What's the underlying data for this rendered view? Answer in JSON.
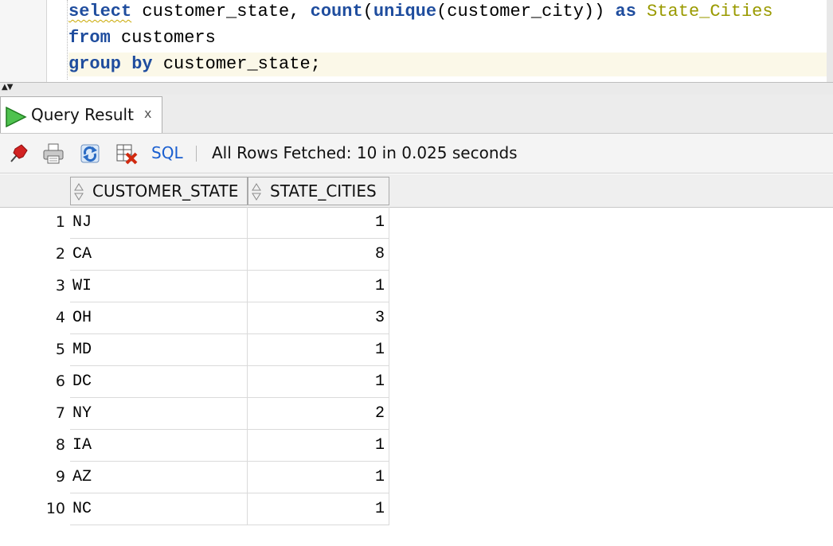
{
  "editor": {
    "line1": {
      "kw_select": "select",
      "text_a": " customer_state, ",
      "kw_count": "count",
      "text_b": "(",
      "kw_unique": "unique",
      "text_c": "(customer_city)) ",
      "kw_as": "as",
      "text_d": " ",
      "alias": "State_Cities"
    },
    "line2": {
      "kw_from": "from",
      "text": " customers"
    },
    "line3": {
      "kw_group_by": "group by",
      "text": " customer_state;"
    }
  },
  "results_tab": {
    "label": "Query Result",
    "close_glyph": "x"
  },
  "toolbar": {
    "icons": [
      "pin-icon",
      "print-icon",
      "refresh-icon",
      "clear-icon"
    ],
    "sql_label": "SQL",
    "status": "All Rows Fetched: 10 in 0.025 seconds"
  },
  "grid": {
    "columns": [
      "CUSTOMER_STATE",
      "STATE_CITIES"
    ],
    "rows": [
      {
        "num": "1",
        "state": "NJ",
        "cities": "1"
      },
      {
        "num": "2",
        "state": "CA",
        "cities": "8"
      },
      {
        "num": "3",
        "state": "WI",
        "cities": "1"
      },
      {
        "num": "4",
        "state": "OH",
        "cities": "3"
      },
      {
        "num": "5",
        "state": "MD",
        "cities": "1"
      },
      {
        "num": "6",
        "state": "DC",
        "cities": "1"
      },
      {
        "num": "7",
        "state": "NY",
        "cities": "2"
      },
      {
        "num": "8",
        "state": "IA",
        "cities": "1"
      },
      {
        "num": "9",
        "state": "AZ",
        "cities": "1"
      },
      {
        "num": "10",
        "state": "NC",
        "cities": "1"
      }
    ]
  },
  "colors": {
    "keyword": "#1f4d9e",
    "alias": "#9a9a00",
    "link": "#1a5fd0",
    "current_line": "#fbf8e8"
  }
}
